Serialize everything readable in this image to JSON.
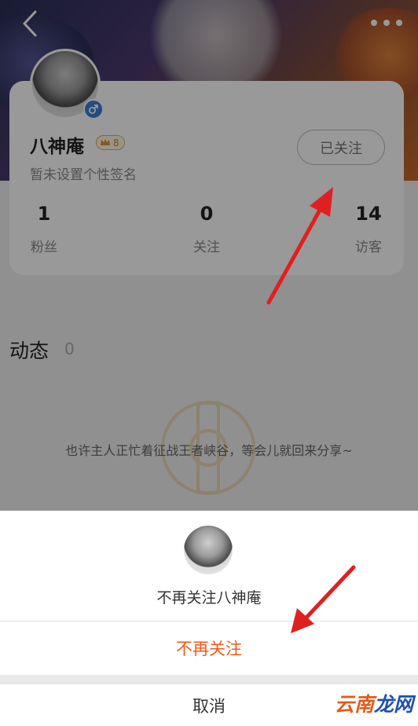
{
  "profile": {
    "name": "八神庵",
    "level": "8",
    "signature": "暂未设置个性签名",
    "follow_state": "已关注",
    "stats": [
      {
        "value": "1",
        "label": "粉丝"
      },
      {
        "value": "0",
        "label": "关注"
      },
      {
        "value": "14",
        "label": "访客"
      }
    ]
  },
  "feed": {
    "title": "动态",
    "count": "0",
    "empty_text": "也许主人正忙着征战王者峡谷，等会儿就回来分享~"
  },
  "sheet": {
    "title": "不再关注八神庵",
    "unfollow_label": "不再关注",
    "cancel_label": "取消"
  },
  "watermark": {
    "part1": "云南",
    "part2": "龙网"
  },
  "colors": {
    "accent": "#f05a1a",
    "gender": "#3b7ddb",
    "arrow": "#e02020"
  },
  "icons": {
    "back": "chevron-left-icon",
    "more": "more-dots-icon",
    "gender": "male-icon",
    "level": "crown-icon"
  }
}
